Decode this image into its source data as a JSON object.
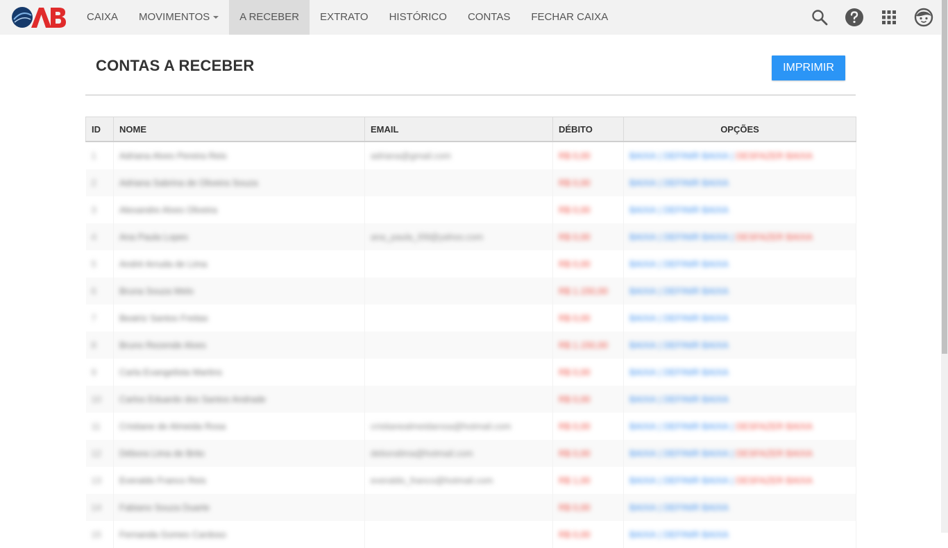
{
  "nav": {
    "items": [
      {
        "label": "CAIXA"
      },
      {
        "label": "MOVIMENTOS",
        "dropdown": true
      },
      {
        "label": "A RECEBER",
        "active": true
      },
      {
        "label": "EXTRATO"
      },
      {
        "label": "HISTÓRICO"
      },
      {
        "label": "CONTAS"
      },
      {
        "label": "FECHAR CAIXA"
      }
    ],
    "tools": [
      "search-icon",
      "help-icon",
      "apps-grid-icon",
      "user-avatar-icon"
    ]
  },
  "page": {
    "title": "CONTAS A RECEBER",
    "print_label": "IMPRIMIR"
  },
  "colors": {
    "primary": "#2b95f6",
    "debit": "#f04a3e",
    "link_blue": "#3b8ff0",
    "link_red": "#f2544a",
    "logo_red": "#e02b2b",
    "logo_navy": "#163a6b"
  },
  "table": {
    "columns": {
      "id": "ID",
      "name": "NOME",
      "email": "EMAIL",
      "debit": "DÉBITO",
      "options": "OPÇÕES"
    },
    "rows": [
      {
        "id": "1",
        "name": "Adriana Alves Pereira Reis",
        "email": "adriana@gmail.com",
        "debit": "R$ 0,00",
        "opt1": "BAIXA",
        "opt2": "DEFINIR BAIXA",
        "opt3": "DESFAZER BAIXA"
      },
      {
        "id": "2",
        "name": "Adriana Sabrina de Oliveira Souza",
        "email": "",
        "debit": "R$ 0,00",
        "opt1": "BAIXA",
        "opt2": "DEFINIR BAIXA",
        "opt3": ""
      },
      {
        "id": "3",
        "name": "Alexandre Alves Oliveira",
        "email": "",
        "debit": "R$ 0,00",
        "opt1": "BAIXA",
        "opt2": "DEFINIR BAIXA",
        "opt3": ""
      },
      {
        "id": "4",
        "name": "Ana Paula Lopes",
        "email": "ana_paula_l09@yahoo.com",
        "debit": "R$ 0,00",
        "opt1": "BAIXA",
        "opt2": "DEFINIR BAIXA",
        "opt3": "DESFAZER BAIXA"
      },
      {
        "id": "5",
        "name": "André Arruda de Lima",
        "email": "",
        "debit": "R$ 0,00",
        "opt1": "BAIXA",
        "opt2": "DEFINIR BAIXA",
        "opt3": ""
      },
      {
        "id": "6",
        "name": "Bruna Souza Melo",
        "email": "",
        "debit": "R$ 1.150,00",
        "opt1": "BAIXA",
        "opt2": "DEFINIR BAIXA",
        "opt3": ""
      },
      {
        "id": "7",
        "name": "Beatriz Santos Freitas",
        "email": "",
        "debit": "R$ 0,00",
        "opt1": "BAIXA",
        "opt2": "DEFINIR BAIXA",
        "opt3": ""
      },
      {
        "id": "8",
        "name": "Bruno Rezende Alves",
        "email": "",
        "debit": "R$ 1.150,00",
        "opt1": "BAIXA",
        "opt2": "DEFINIR BAIXA",
        "opt3": ""
      },
      {
        "id": "9",
        "name": "Carla Evangelista Martins",
        "email": "",
        "debit": "R$ 0,00",
        "opt1": "BAIXA",
        "opt2": "DEFINIR BAIXA",
        "opt3": ""
      },
      {
        "id": "10",
        "name": "Carlos Eduardo dos Santos Andrade",
        "email": "",
        "debit": "R$ 0,00",
        "opt1": "BAIXA",
        "opt2": "DEFINIR BAIXA",
        "opt3": ""
      },
      {
        "id": "11",
        "name": "Cristiane de Almeida Rosa",
        "email": "cristianealmeidarosa@hotmail.com",
        "debit": "R$ 0,00",
        "opt1": "BAIXA",
        "opt2": "DEFINIR BAIXA",
        "opt3": "DESFAZER BAIXA"
      },
      {
        "id": "12",
        "name": "Débora Lima de Brito",
        "email": "deboralima@hotmail.com",
        "debit": "R$ 0,00",
        "opt1": "BAIXA",
        "opt2": "DEFINIR BAIXA",
        "opt3": "DESFAZER BAIXA"
      },
      {
        "id": "13",
        "name": "Everaldo Franco Reis",
        "email": "everaldo_franco@hotmail.com",
        "debit": "R$ 1,00",
        "opt1": "BAIXA",
        "opt2": "DEFINIR BAIXA",
        "opt3": "DESFAZER BAIXA"
      },
      {
        "id": "14",
        "name": "Fabiano Souza Duarte",
        "email": "",
        "debit": "R$ 0,00",
        "opt1": "BAIXA",
        "opt2": "DEFINIR BAIXA",
        "opt3": ""
      },
      {
        "id": "15",
        "name": "Fernanda Gomes Cardoso",
        "email": "",
        "debit": "R$ 0,00",
        "opt1": "BAIXA",
        "opt2": "DEFINIR BAIXA",
        "opt3": ""
      }
    ]
  }
}
